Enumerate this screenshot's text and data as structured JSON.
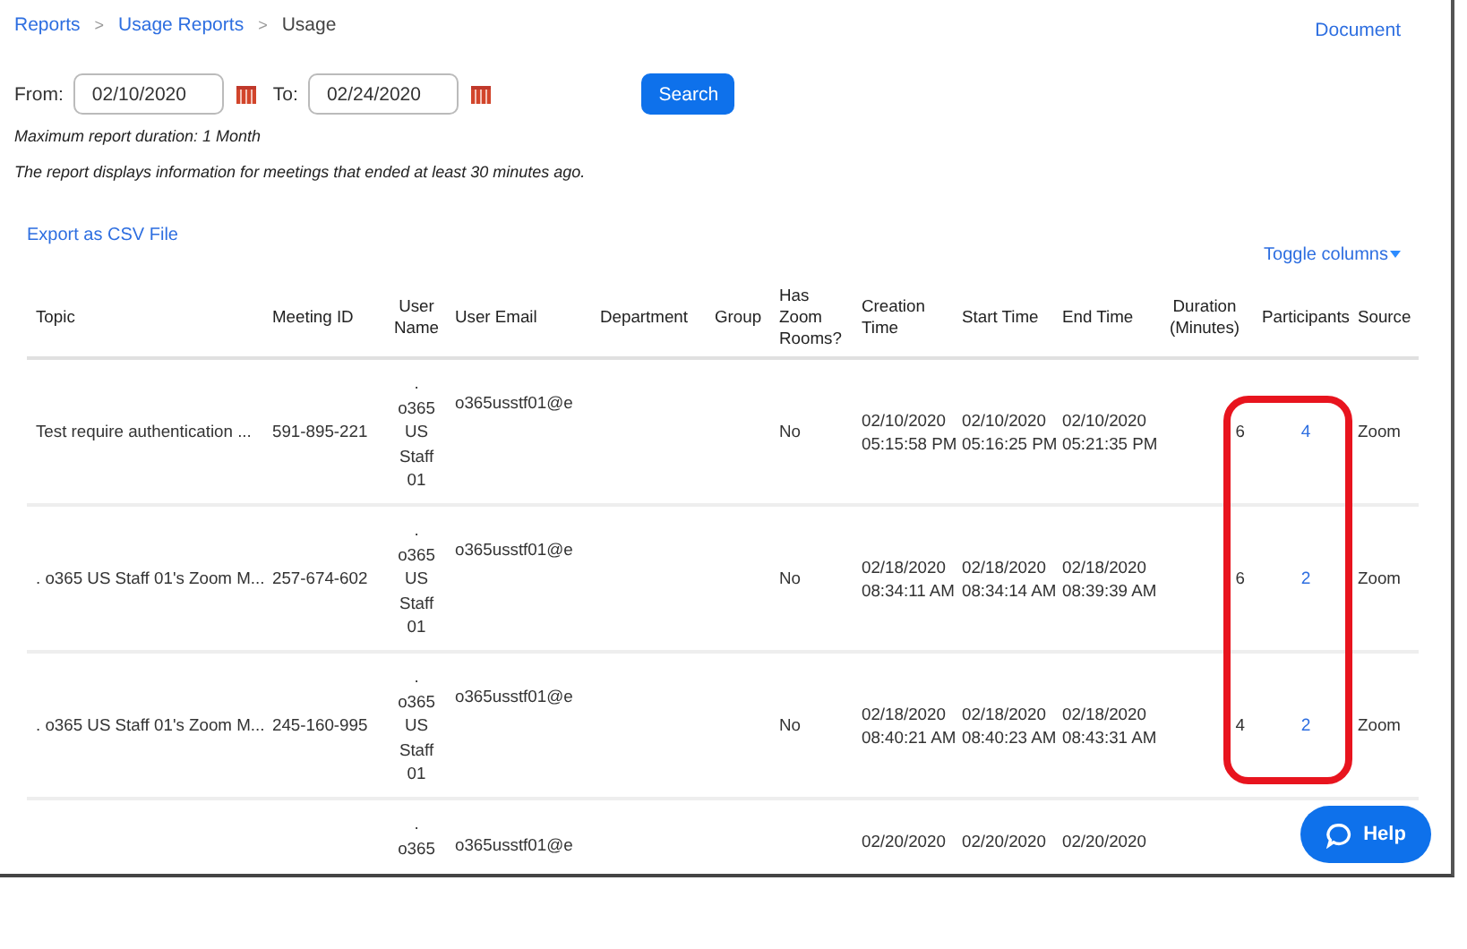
{
  "breadcrumb": [
    {
      "label": "Reports",
      "link": true
    },
    {
      "label": "Usage Reports",
      "link": true
    },
    {
      "label": "Usage",
      "link": false
    }
  ],
  "breadcrumb_separator": ">",
  "document_link": "Document",
  "filters": {
    "from_label": "From:",
    "from_value": "02/10/2020",
    "to_label": "To:",
    "to_value": "02/24/2020",
    "search_button": "Search"
  },
  "notes": [
    "Maximum report duration: 1 Month",
    "The report displays information for meetings that ended at least 30 minutes ago."
  ],
  "export_link": "Export as CSV File",
  "toggle_columns": "Toggle columns",
  "table": {
    "columns": [
      "Topic",
      "Meeting ID",
      "User Name",
      "User Email",
      "Department",
      "Group",
      "Has Zoom Rooms?",
      "Creation Time",
      "Start Time",
      "End Time",
      "Duration (Minutes)",
      "Participants",
      "Source"
    ],
    "rows": [
      {
        "topic": "Test require authentication ...",
        "meeting_id": "591-895-221",
        "user_name": ". o365 US Staff 01",
        "user_email": "o365usstf01@e",
        "department": "",
        "group": "",
        "has_zoom_rooms": "No",
        "creation_time": "02/10/2020 05:15:58 PM",
        "start_time": "02/10/2020 05:16:25 PM",
        "end_time": "02/10/2020 05:21:35 PM",
        "duration": "6",
        "participants": "4",
        "source": "Zoom"
      },
      {
        "topic": ". o365 US Staff 01's Zoom M...",
        "meeting_id": "257-674-602",
        "user_name": ". o365 US Staff 01",
        "user_email": "o365usstf01@e",
        "department": "",
        "group": "",
        "has_zoom_rooms": "No",
        "creation_time": "02/18/2020 08:34:11 AM",
        "start_time": "02/18/2020 08:34:14 AM",
        "end_time": "02/18/2020 08:39:39 AM",
        "duration": "6",
        "participants": "2",
        "source": "Zoom"
      },
      {
        "topic": ". o365 US Staff 01's Zoom M...",
        "meeting_id": "245-160-995",
        "user_name": ". o365 US Staff 01",
        "user_email": "o365usstf01@e",
        "department": "",
        "group": "",
        "has_zoom_rooms": "No",
        "creation_time": "02/18/2020 08:40:21 AM",
        "start_time": "02/18/2020 08:40:23 AM",
        "end_time": "02/18/2020 08:43:31 AM",
        "duration": "4",
        "participants": "2",
        "source": "Zoom"
      },
      {
        "topic": "",
        "meeting_id": "",
        "user_name": ". o365",
        "user_email": "o365usstf01@e",
        "department": "",
        "group": "",
        "has_zoom_rooms": "",
        "creation_time": "02/20/2020",
        "start_time": "02/20/2020",
        "end_time": "02/20/2020",
        "duration": "",
        "participants": "",
        "source": ""
      }
    ]
  },
  "help_button": "Help",
  "annotation": {
    "color": "#e8141e"
  }
}
